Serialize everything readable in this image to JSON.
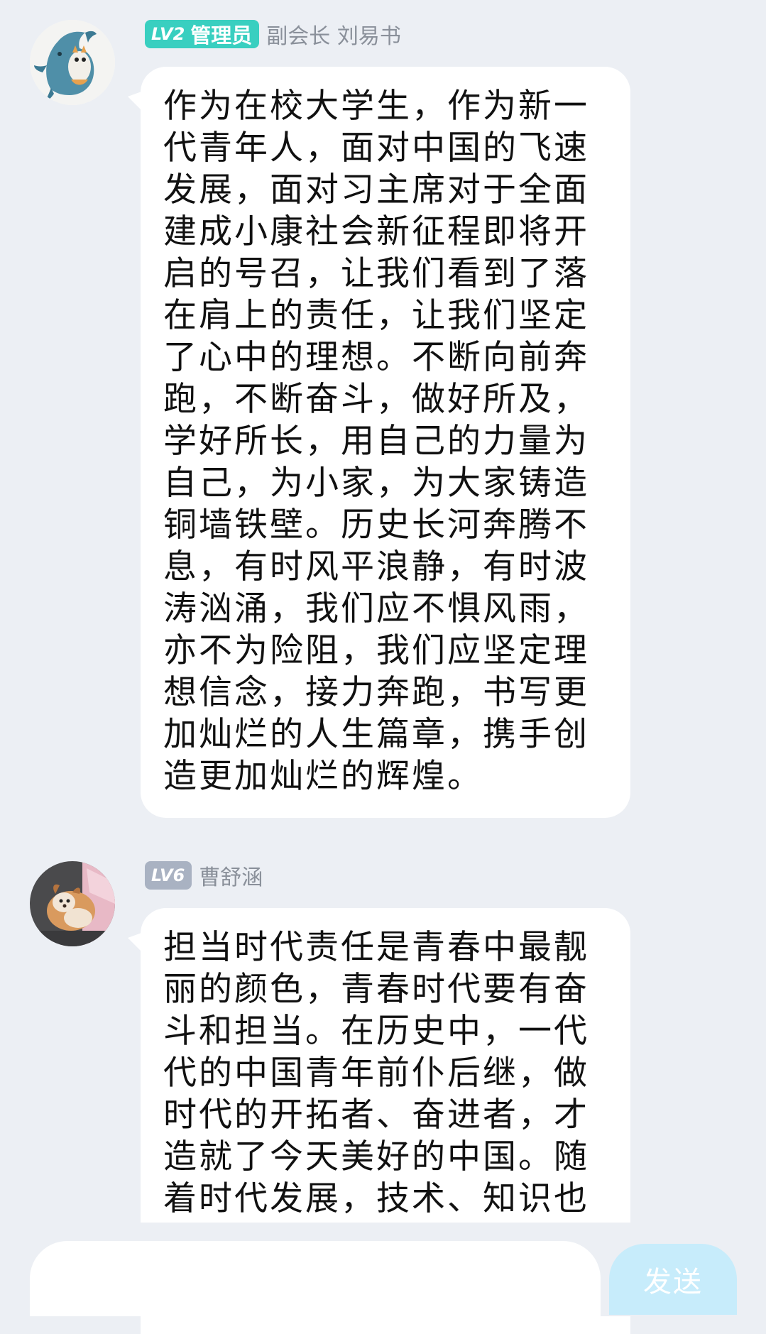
{
  "messages": [
    {
      "level": "LV2",
      "role": "管理员",
      "name": "副会长 刘易书",
      "avatar": "shark-cat-avatar",
      "text": "作为在校大学生，作为新一代青年人，面对中国的飞速发展，面对习主席对于全面建成小康社会新征程即将开启的号召，让我们看到了落在肩上的责任，让我们坚定了心中的理想。不断向前奔跑，不断奋斗，做好所及，学好所长，用自己的力量为自己，为小家，为大家铸造铜墙铁壁。历史长河奔腾不息，有时风平浪静，有时波涛汹涌，我们应不惧风雨，亦不为险阻，我们应坚定理想信念，接力奔跑，书写更加灿烂的人生篇章，携手创造更加灿烂的辉煌。"
    },
    {
      "level": "LV6",
      "role": "",
      "name": "曹舒涵",
      "avatar": "puppy-avatar",
      "text": "担当时代责任是青春中最靓丽的颜色，青春时代要有奋斗和担当。在历史中，一代代的中国青年前仆后继，做时代的开拓者、奋进者，才造就了今天美好的中国。随着时代发展，技术、知识也"
    }
  ],
  "input_bar": {
    "value": "",
    "send_label": "发送"
  },
  "colors": {
    "background": "#eceff4",
    "bubble": "#ffffff",
    "admin_badge": "#39cfc0",
    "member_badge": "#a9b2c2",
    "name_text": "#8a909a",
    "send_button": "#c7ecfb"
  }
}
